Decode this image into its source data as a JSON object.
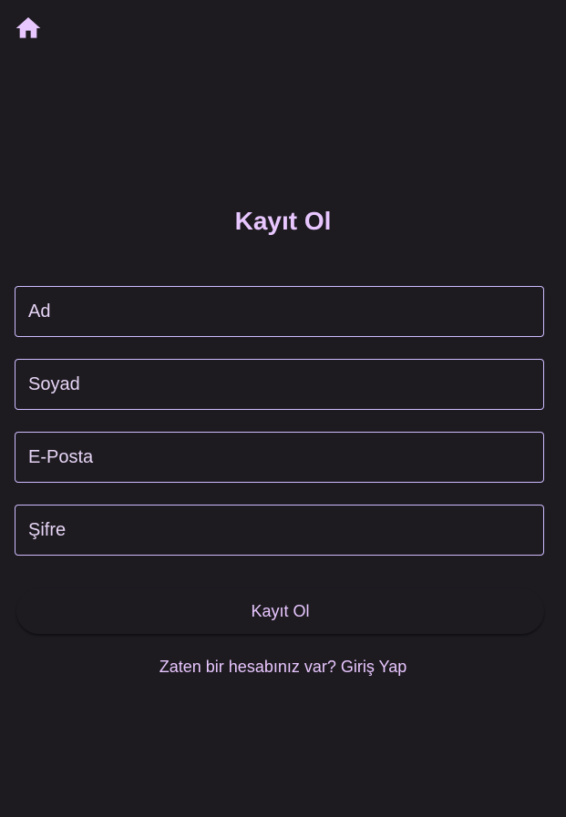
{
  "header": {
    "home_icon": "home-icon"
  },
  "form": {
    "title": "Kayıt Ol",
    "fields": [
      {
        "placeholder": "Ad",
        "value": ""
      },
      {
        "placeholder": "Soyad",
        "value": ""
      },
      {
        "placeholder": "E-Posta",
        "value": ""
      },
      {
        "placeholder": "Şifre",
        "value": ""
      }
    ],
    "submit_label": "Kayıt Ol",
    "login_prompt": "Zaten bir hesabınız var? Giriş Yap"
  },
  "colors": {
    "background": "#1d1b20",
    "accent": "#e8c6ff",
    "border": "#cfbcff"
  }
}
